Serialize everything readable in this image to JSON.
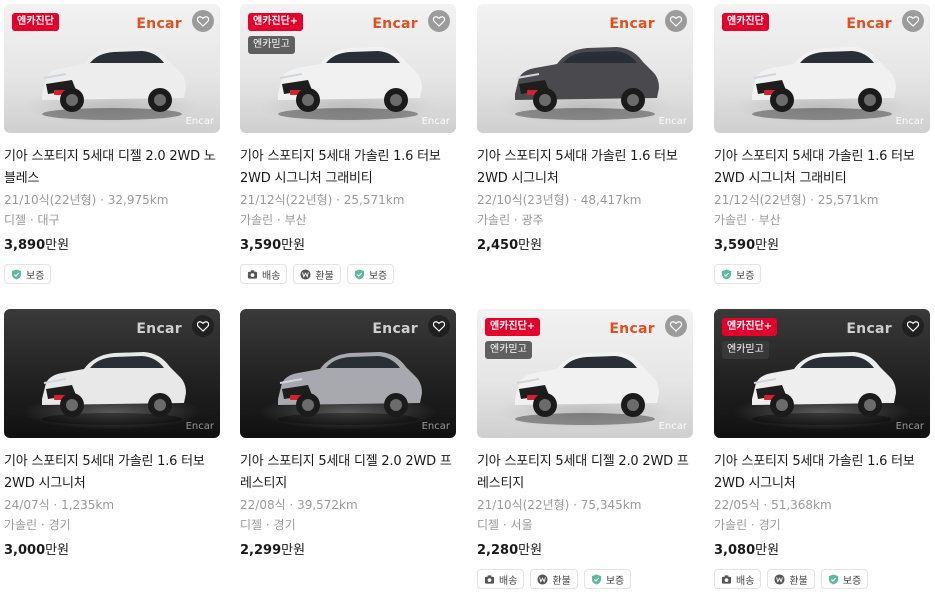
{
  "colors": {
    "badge_red": "#e4002b",
    "price_text": "#1a1a1a",
    "meta_text": "#9a9a9a",
    "shield_green": "#5ab9a0"
  },
  "cards": [
    {
      "theme": "light",
      "car_color": "#ededed",
      "badges": {
        "diag": "엔카진단",
        "guarantee": ""
      },
      "watermark_top": "Encar",
      "watermark_bottom": "Encar",
      "title_l1": "기아 스포티지 5세대 디젤 2.0 2WD 노",
      "title_l2": "블레스",
      "spec": "21/10식(22년형) · 32,975km",
      "region": "디젤 · 대구",
      "price": "3,890",
      "price_unit": "만원",
      "chips": [
        {
          "icon": "shield-icon",
          "label": "보증"
        }
      ]
    },
    {
      "theme": "light",
      "car_color": "#f1f1f1",
      "badges": {
        "diag": "엔카진단+",
        "guarantee": "엔카믿고"
      },
      "watermark_top": "Encar",
      "watermark_bottom": "Encar",
      "title_l1": "기아 스포티지 5세대 가솔린 1.6 터보",
      "title_l2": "2WD 시그니처 그래비티",
      "spec": "21/12식(22년형) · 25,571km",
      "region": "가솔린 · 부산",
      "price": "3,590",
      "price_unit": "만원",
      "chips": [
        {
          "icon": "camera-icon",
          "label": "배송"
        },
        {
          "icon": "won-icon",
          "label": "환불"
        },
        {
          "icon": "shield-icon",
          "label": "보증"
        }
      ]
    },
    {
      "theme": "light",
      "car_color": "#4a4a4e",
      "badges": {
        "diag": "",
        "guarantee": ""
      },
      "watermark_top": "Encar",
      "watermark_bottom": "Encar",
      "title_l1": "기아 스포티지 5세대 가솔린 1.6 터보",
      "title_l2": "2WD 시그니처",
      "spec": "22/10식(23년형) · 48,417km",
      "region": "가솔린 · 광주",
      "price": "2,450",
      "price_unit": "만원",
      "chips": []
    },
    {
      "theme": "light",
      "car_color": "#f1f1f1",
      "badges": {
        "diag": "엔카진단",
        "guarantee": ""
      },
      "watermark_top": "Encar",
      "watermark_bottom": "Encar",
      "title_l1": "기아 스포티지 5세대 가솔린 1.6 터보",
      "title_l2": "2WD 시그니처 그래비티",
      "spec": "21/12식(22년형) · 25,571km",
      "region": "가솔린 · 부산",
      "price": "3,590",
      "price_unit": "만원",
      "chips": [
        {
          "icon": "shield-icon",
          "label": "보증"
        }
      ]
    },
    {
      "theme": "dark",
      "car_color": "#e8e8e8",
      "badges": {
        "diag": "",
        "guarantee": ""
      },
      "watermark_top": "Encar",
      "watermark_bottom": "Encar",
      "title_l1": "기아 스포티지 5세대 가솔린 1.6 터보",
      "title_l2": "2WD 시그니처",
      "spec": "24/07식 · 1,235km",
      "region": "가솔린 · 경기",
      "price": "3,000",
      "price_unit": "만원",
      "chips": []
    },
    {
      "theme": "dark",
      "car_color": "#a7a9ae",
      "badges": {
        "diag": "",
        "guarantee": ""
      },
      "watermark_top": "Encar",
      "watermark_bottom": "Encar",
      "title_l1": "기아 스포티지 5세대 디젤 2.0 2WD 프",
      "title_l2": "레스티지",
      "spec": "22/08식 · 39,572km",
      "region": "디젤 · 경기",
      "price": "2,299",
      "price_unit": "만원",
      "chips": []
    },
    {
      "theme": "light",
      "car_color": "#f1f1f1",
      "badges": {
        "diag": "엔카진단+",
        "guarantee": "엔카믿고"
      },
      "watermark_top": "Encar",
      "watermark_bottom": "Encar",
      "title_l1": "기아 스포티지 5세대 디젤 2.0 2WD 프",
      "title_l2": "레스티지",
      "spec": "21/10식(22년형) · 75,345km",
      "region": "디젤 · 서울",
      "price": "2,280",
      "price_unit": "만원",
      "chips": [
        {
          "icon": "camera-icon",
          "label": "배송"
        },
        {
          "icon": "won-icon",
          "label": "환불"
        },
        {
          "icon": "shield-icon",
          "label": "보증"
        }
      ]
    },
    {
      "theme": "dark",
      "car_color": "#eeeeee",
      "badges": {
        "diag": "엔카진단+",
        "guarantee": "엔카믿고"
      },
      "watermark_top": "Encar",
      "watermark_bottom": "Encar",
      "title_l1": "기아 스포티지 5세대 가솔린 1.6 터보",
      "title_l2": "2WD 시그니처",
      "spec": "22/05식 · 51,368km",
      "region": "가솔린 · 경기",
      "price": "3,080",
      "price_unit": "만원",
      "chips": [
        {
          "icon": "camera-icon",
          "label": "배송"
        },
        {
          "icon": "won-icon",
          "label": "환불"
        },
        {
          "icon": "shield-icon",
          "label": "보증"
        }
      ]
    }
  ]
}
